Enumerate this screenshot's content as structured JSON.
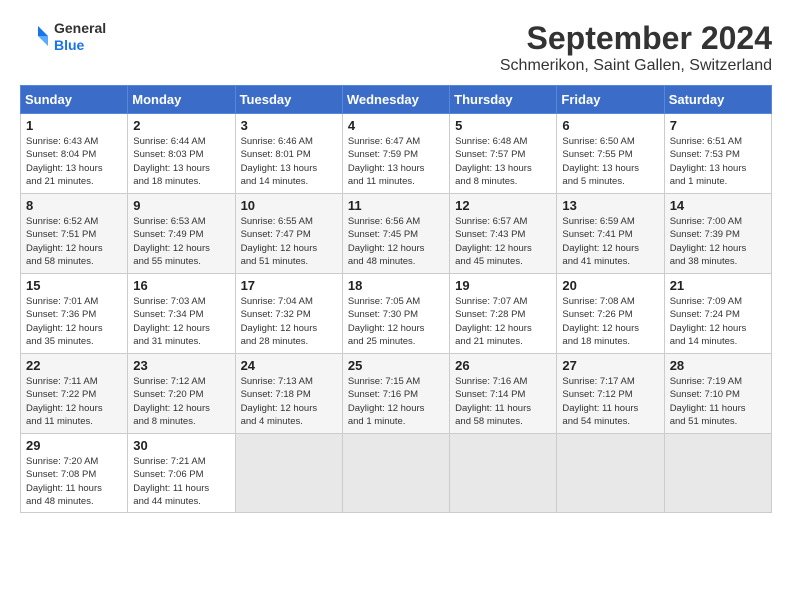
{
  "header": {
    "logo": {
      "line1": "General",
      "line2": "Blue"
    },
    "title": "September 2024",
    "location": "Schmerikon, Saint Gallen, Switzerland"
  },
  "calendar": {
    "days_of_week": [
      "Sunday",
      "Monday",
      "Tuesday",
      "Wednesday",
      "Thursday",
      "Friday",
      "Saturday"
    ],
    "weeks": [
      [
        {
          "day": "",
          "empty": true
        },
        {
          "day": "",
          "empty": true
        },
        {
          "day": "",
          "empty": true
        },
        {
          "day": "",
          "empty": true
        },
        {
          "day": "",
          "empty": true
        },
        {
          "day": "",
          "empty": true
        },
        {
          "day": "",
          "empty": true
        }
      ]
    ],
    "cells": [
      {
        "num": "1",
        "info": "Sunrise: 6:43 AM\nSunset: 8:04 PM\nDaylight: 13 hours\nand 21 minutes."
      },
      {
        "num": "2",
        "info": "Sunrise: 6:44 AM\nSunset: 8:03 PM\nDaylight: 13 hours\nand 18 minutes."
      },
      {
        "num": "3",
        "info": "Sunrise: 6:46 AM\nSunset: 8:01 PM\nDaylight: 13 hours\nand 14 minutes."
      },
      {
        "num": "4",
        "info": "Sunrise: 6:47 AM\nSunset: 7:59 PM\nDaylight: 13 hours\nand 11 minutes."
      },
      {
        "num": "5",
        "info": "Sunrise: 6:48 AM\nSunset: 7:57 PM\nDaylight: 13 hours\nand 8 minutes."
      },
      {
        "num": "6",
        "info": "Sunrise: 6:50 AM\nSunset: 7:55 PM\nDaylight: 13 hours\nand 5 minutes."
      },
      {
        "num": "7",
        "info": "Sunrise: 6:51 AM\nSunset: 7:53 PM\nDaylight: 13 hours\nand 1 minute."
      },
      {
        "num": "8",
        "info": "Sunrise: 6:52 AM\nSunset: 7:51 PM\nDaylight: 12 hours\nand 58 minutes."
      },
      {
        "num": "9",
        "info": "Sunrise: 6:53 AM\nSunset: 7:49 PM\nDaylight: 12 hours\nand 55 minutes."
      },
      {
        "num": "10",
        "info": "Sunrise: 6:55 AM\nSunset: 7:47 PM\nDaylight: 12 hours\nand 51 minutes."
      },
      {
        "num": "11",
        "info": "Sunrise: 6:56 AM\nSunset: 7:45 PM\nDaylight: 12 hours\nand 48 minutes."
      },
      {
        "num": "12",
        "info": "Sunrise: 6:57 AM\nSunset: 7:43 PM\nDaylight: 12 hours\nand 45 minutes."
      },
      {
        "num": "13",
        "info": "Sunrise: 6:59 AM\nSunset: 7:41 PM\nDaylight: 12 hours\nand 41 minutes."
      },
      {
        "num": "14",
        "info": "Sunrise: 7:00 AM\nSunset: 7:39 PM\nDaylight: 12 hours\nand 38 minutes."
      },
      {
        "num": "15",
        "info": "Sunrise: 7:01 AM\nSunset: 7:36 PM\nDaylight: 12 hours\nand 35 minutes."
      },
      {
        "num": "16",
        "info": "Sunrise: 7:03 AM\nSunset: 7:34 PM\nDaylight: 12 hours\nand 31 minutes."
      },
      {
        "num": "17",
        "info": "Sunrise: 7:04 AM\nSunset: 7:32 PM\nDaylight: 12 hours\nand 28 minutes."
      },
      {
        "num": "18",
        "info": "Sunrise: 7:05 AM\nSunset: 7:30 PM\nDaylight: 12 hours\nand 25 minutes."
      },
      {
        "num": "19",
        "info": "Sunrise: 7:07 AM\nSunset: 7:28 PM\nDaylight: 12 hours\nand 21 minutes."
      },
      {
        "num": "20",
        "info": "Sunrise: 7:08 AM\nSunset: 7:26 PM\nDaylight: 12 hours\nand 18 minutes."
      },
      {
        "num": "21",
        "info": "Sunrise: 7:09 AM\nSunset: 7:24 PM\nDaylight: 12 hours\nand 14 minutes."
      },
      {
        "num": "22",
        "info": "Sunrise: 7:11 AM\nSunset: 7:22 PM\nDaylight: 12 hours\nand 11 minutes."
      },
      {
        "num": "23",
        "info": "Sunrise: 7:12 AM\nSunset: 7:20 PM\nDaylight: 12 hours\nand 8 minutes."
      },
      {
        "num": "24",
        "info": "Sunrise: 7:13 AM\nSunset: 7:18 PM\nDaylight: 12 hours\nand 4 minutes."
      },
      {
        "num": "25",
        "info": "Sunrise: 7:15 AM\nSunset: 7:16 PM\nDaylight: 12 hours\nand 1 minute."
      },
      {
        "num": "26",
        "info": "Sunrise: 7:16 AM\nSunset: 7:14 PM\nDaylight: 11 hours\nand 58 minutes."
      },
      {
        "num": "27",
        "info": "Sunrise: 7:17 AM\nSunset: 7:12 PM\nDaylight: 11 hours\nand 54 minutes."
      },
      {
        "num": "28",
        "info": "Sunrise: 7:19 AM\nSunset: 7:10 PM\nDaylight: 11 hours\nand 51 minutes."
      },
      {
        "num": "29",
        "info": "Sunrise: 7:20 AM\nSunset: 7:08 PM\nDaylight: 11 hours\nand 48 minutes."
      },
      {
        "num": "30",
        "info": "Sunrise: 7:21 AM\nSunset: 7:06 PM\nDaylight: 11 hours\nand 44 minutes."
      }
    ]
  }
}
